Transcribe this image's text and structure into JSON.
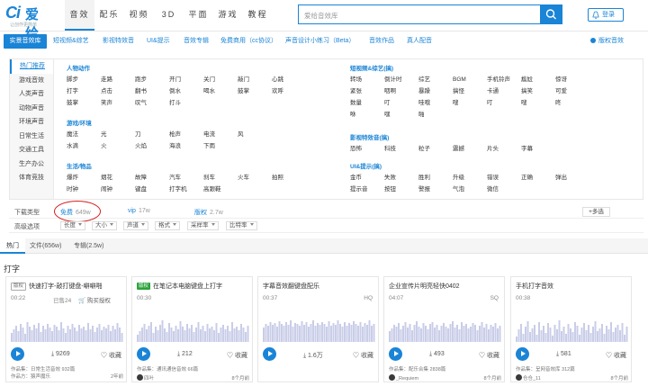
{
  "logo": {
    "mark": "Ci",
    "name": "爱给",
    "slogan": "让创作更简单"
  },
  "nav": [
    "音效",
    "配乐",
    "视频",
    "3D",
    "平面",
    "游戏",
    "教程"
  ],
  "search": {
    "placeholder": "爱给音效库"
  },
  "login_label": "登录",
  "catbar": {
    "first": "实景音效库",
    "items": [
      "短视频&综艺",
      "影视特效音",
      "UI&提示",
      "音效专辑",
      "免费商用（cc协议）",
      "声音设计小练习（Beta）",
      "音效作品",
      "真人配音"
    ],
    "right": "版权音效"
  },
  "categories": [
    "热门推荐",
    "游戏音效",
    "人类声音",
    "动物声音",
    "环境声音",
    "日常生活",
    "交通工具",
    "生产办公",
    "体育竞技"
  ],
  "groups": [
    {
      "title": "人物动作",
      "rows": [
        [
          "脚步",
          "走路",
          "跑步",
          "开门",
          "关门",
          "敲门",
          "心跳"
        ],
        [
          "打字",
          "点击",
          "翻书",
          "倒水",
          "喝水",
          "鼓掌",
          "欢呼"
        ],
        [
          "鼓掌",
          "笑声",
          "叹气",
          "打斗"
        ]
      ]
    },
    {
      "title": "游戏/环境",
      "rows": [
        [
          "魔法",
          "光",
          "刀",
          "枪声",
          "电流",
          "风"
        ],
        [
          "水滴",
          "火",
          "火焰",
          "海浪",
          "下雨"
        ]
      ]
    },
    {
      "title": "生活/物品",
      "rows": [
        [
          "爆炸",
          "烟花",
          "故障",
          "汽车",
          "刹车",
          "火车",
          "拍照"
        ],
        [
          "时钟",
          "闹钟",
          "键盘",
          "打字机",
          "高跟鞋"
        ]
      ]
    },
    {
      "title": "短视频&综艺(搞)",
      "rows": [
        [
          "转场",
          "倒计时",
          "综艺",
          "BGM",
          "手机铃声",
          "尴尬",
          "惊讶"
        ],
        [
          "紧张",
          "咽啊",
          "暴躁",
          "搞怪",
          "卡通",
          "搞笑",
          "可爱"
        ],
        [
          "数量",
          "叮",
          "哇哦",
          "嗖",
          "叮",
          "嗖",
          "咚"
        ],
        [
          "咻",
          "嘿",
          "啪"
        ]
      ]
    },
    {
      "title": "影视特效音(搞)",
      "rows": [
        [
          "恐怖",
          "科技",
          "粒子",
          "震撼",
          "片头",
          "字幕"
        ]
      ]
    },
    {
      "title": "UI&提示(搞)",
      "rows": [
        [
          "金币",
          "失败",
          "胜利",
          "升级",
          "错误",
          "正确",
          "弹出"
        ],
        [
          "提示音",
          "按钮",
          "警报",
          "气泡",
          "微信"
        ]
      ]
    }
  ],
  "filters": {
    "row1_label": "下载类型",
    "opt1": {
      "label": "免费",
      "count": "649w"
    },
    "opt2": {
      "label": "vip",
      "count": "17w"
    },
    "opt3": {
      "label": "版权",
      "count": "2.7w"
    },
    "more": "+多选",
    "row2_label": "高级选项",
    "selects": [
      "长度",
      "大小",
      "声道",
      "格式",
      "采样率",
      "比特率"
    ]
  },
  "tabs": [
    "热门",
    "文件(656w)",
    "专辑(2.5w)"
  ],
  "query_title": "打字",
  "cards": [
    {
      "tag": "版权",
      "title": "快速打字-敲打键盘-噼噼啪",
      "duration": "00:22",
      "meta": "已售24",
      "meta2": "购买授权",
      "downloads": "9269",
      "fav": "收藏",
      "line1": "作品集：日常生活音效 932篇",
      "line2": "作品方：猿声魔乐",
      "time": "2年前",
      "heights": [
        10,
        14,
        18,
        12,
        20,
        16,
        9,
        22,
        17,
        13,
        19,
        15,
        21,
        11,
        18,
        14,
        20,
        16,
        12,
        19,
        17,
        13,
        22,
        15,
        10,
        18,
        14,
        20,
        16,
        12,
        19,
        15,
        17,
        13,
        21,
        14,
        18,
        11,
        16,
        20,
        13,
        17,
        15,
        19,
        12,
        18,
        14,
        21,
        16,
        10
      ]
    },
    {
      "tag": "版权",
      "tagcolor": "g",
      "title": "在笔记本电脑键盘上打字",
      "duration": "00:30",
      "meta": "",
      "meta2": "",
      "downloads": "212",
      "fav": "收藏",
      "line1": "作品集：通讯通信音效 66篇",
      "line2": "四叶",
      "time": "8个月前",
      "heights": [
        8,
        12,
        16,
        20,
        14,
        18,
        22,
        10,
        17,
        13,
        19,
        24,
        15,
        11,
        21,
        16,
        12,
        18,
        14,
        23,
        17,
        13,
        20,
        15,
        19,
        11,
        16,
        22,
        14,
        18,
        12,
        20,
        15,
        17,
        13,
        21,
        10,
        16,
        19,
        14,
        18,
        12,
        22,
        15,
        17,
        13,
        20,
        16,
        11,
        18
      ]
    },
    {
      "tag": "",
      "title": "字幕音效翻键盘配乐",
      "duration": "00:37",
      "meta": "HQ",
      "meta2": "",
      "downloads": "1.6万",
      "fav": "收藏",
      "line1": "",
      "line2": "",
      "time": "",
      "heights": [
        16,
        20,
        18,
        22,
        19,
        21,
        17,
        23,
        20,
        18,
        22,
        19,
        24,
        17,
        21,
        20,
        18,
        23,
        19,
        22,
        17,
        20,
        24,
        18,
        21,
        19,
        22,
        20,
        17,
        23,
        18,
        21,
        19,
        24,
        20,
        17,
        22,
        18,
        21,
        19,
        23,
        20,
        18,
        22,
        17,
        21,
        19,
        24,
        18,
        20
      ]
    },
    {
      "tag": "",
      "title": "企业宣传片明亮轻快0402",
      "duration": "04:07",
      "meta": "SQ",
      "meta2": "",
      "downloads": "493",
      "fav": "收藏",
      "line1": "作品集：配乐合集 2838篇",
      "line2": "_Requiem",
      "time": "8个月前",
      "heights": [
        12,
        15,
        19,
        17,
        21,
        14,
        18,
        22,
        16,
        20,
        13,
        19,
        23,
        17,
        15,
        21,
        18,
        14,
        20,
        22,
        16,
        19,
        13,
        18,
        21,
        17,
        15,
        20,
        23,
        16,
        19,
        14,
        22,
        18,
        20,
        15,
        17,
        21,
        19,
        13,
        18,
        22,
        16,
        20,
        14,
        19,
        17,
        21,
        15,
        18
      ]
    },
    {
      "tag": "",
      "title": "手机打字音效",
      "duration": "00:38",
      "meta": "",
      "meta2": "",
      "downloads": "581",
      "fav": "收藏",
      "line1": "作品集：呈网音效库 312篇",
      "line2": "仓仓_11",
      "time": "8个月前",
      "heights": [
        6,
        14,
        20,
        9,
        17,
        23,
        11,
        15,
        19,
        8,
        22,
        13,
        18,
        10,
        21,
        16,
        7,
        19,
        14,
        24,
        12,
        17,
        9,
        20,
        15,
        11,
        22,
        18,
        8,
        16,
        21,
        13,
        19,
        10,
        17,
        23,
        12,
        15,
        20,
        9,
        18,
        14,
        22,
        11,
        16,
        19,
        13,
        21,
        8,
        17
      ]
    }
  ]
}
